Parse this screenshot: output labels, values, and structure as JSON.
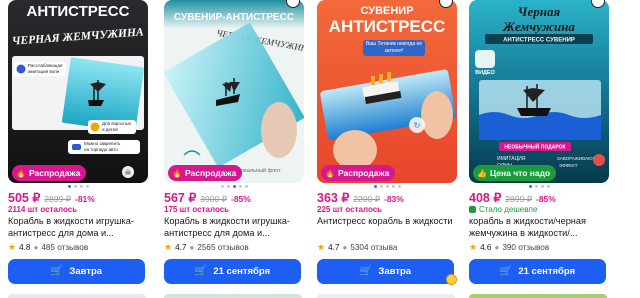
{
  "cards": [
    {
      "image_text": {
        "headline": "АНТИСТРЕСС",
        "subline": "ЧЕРНАЯ ЖЕМЧУЖИНА",
        "feature1": "Расслабляющая имитация волн",
        "feature2": "Для взрослых и детей",
        "feature3": "Можно закрепить на торпедо авто"
      },
      "badge": "Распродажа",
      "price": "505 ₽",
      "old_price": "2899 ₽",
      "discount": "-81%",
      "stock": "2114 шт осталось",
      "title_line1": "Корабль в жидкости игрушка-",
      "title_line2": "антистресс для дома и...",
      "rating": "4.8",
      "reviews": "485 отзывов",
      "cta": "Завтра",
      "colors": {
        "badge": "#d6178f"
      }
    },
    {
      "image_text": {
        "headline": "СУВЕНИР-АНТИСТРЕСС",
        "subline": "ЧЕРНАЯ ЖЕМЧУЖИНА",
        "footer": "супер занимательно реальный флот"
      },
      "badge": "Распродажа",
      "price": "567 ₽",
      "old_price": "3900 ₽",
      "discount": "-85%",
      "stock": "175 шт осталось",
      "title_line1": "Корабль в жидкости игрушка-",
      "title_line2": "антистресс для дома и...",
      "rating": "4.7",
      "reviews": "2565 отзывов",
      "cta": "21 сентября",
      "colors": {
        "badge": "#d6178f"
      }
    },
    {
      "image_text": {
        "headline1": "СУВЕНИР",
        "headline2": "АНТИСТРЕСС",
        "note": "Ваш Титаник никогда не затонет!"
      },
      "badge": "Распродажа",
      "price": "363 ₽",
      "old_price": "2200 ₽",
      "discount": "-83%",
      "stock": "225 шт осталось",
      "title_line1": "Антистресс корабль в жидкости",
      "title_line2": "",
      "rating": "4.7",
      "reviews": "5304 отзыва",
      "cta": "Завтра",
      "colors": {
        "badge": "#d6178f"
      }
    },
    {
      "image_text": {
        "headline1": "Черная",
        "headline2": "Жемчужина",
        "ribbon": "АНТИСТРЕСС СУВЕНИР",
        "video": "ВИДЕО",
        "gift": "НЕОБЫЧНЫЙ ПОДАРОК",
        "f1": "ИМИТАЦИЯ",
        "f2": "ЗАВОРАЖИВАЮЩИЕ",
        "f3": "ОЛНЫ",
        "f4": "ЭФФЕКТ"
      },
      "badge": "Цена что надо",
      "price": "408 ₽",
      "old_price": "2899 ₽",
      "discount": "-85%",
      "stock": "Стало дешевле",
      "title_line1": "корабль в жидкости/черная",
      "title_line2": "жемчужина в жидкости/...",
      "rating": "4.6",
      "reviews": "390 отзывов",
      "cta": "21 сентября",
      "colors": {
        "badge": "#1a9b3c"
      }
    }
  ],
  "colors": {
    "accent": "#1d5ff2",
    "price": "#d6178f",
    "star": "#f2a20e"
  },
  "icons": [
    "heart-icon",
    "fire-icon",
    "cart-icon",
    "star-icon",
    "chat-bubble-icon"
  ]
}
